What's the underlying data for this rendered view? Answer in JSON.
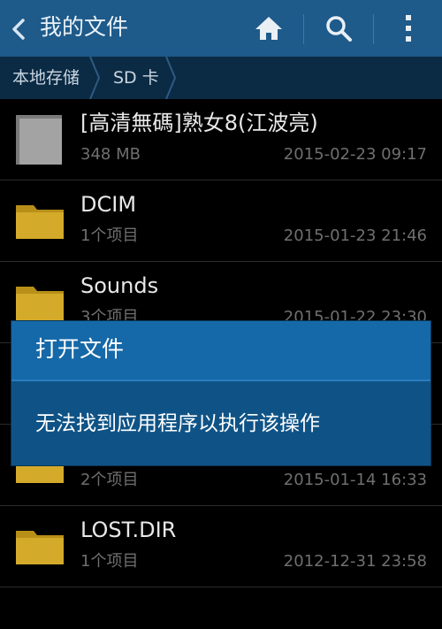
{
  "action_bar": {
    "title": "我的文件",
    "icons": [
      "back-icon",
      "home-icon",
      "search-icon",
      "more-icon"
    ],
    "color": "#1e5a8a"
  },
  "breadcrumb": {
    "items": [
      "本地存储",
      "SD 卡"
    ]
  },
  "files": [
    {
      "name": "[高清無碼]熟女8(江波亮)",
      "sub": "348 MB",
      "date": "2015-02-23 09:17",
      "icon": "file-icon"
    },
    {
      "name": "DCIM",
      "sub": "1个项目",
      "date": "2015-01-23 21:46",
      "icon": "folder-icon"
    },
    {
      "name": "Sounds",
      "sub": "3个项目",
      "date": "2015-01-22 23:30",
      "icon": "folder-icon"
    },
    {
      "name": "",
      "sub": "",
      "date": "",
      "icon": "folder-icon"
    },
    {
      "name": "",
      "sub": "2个项目",
      "date": "2015-01-14 16:33",
      "icon": "folder-icon"
    },
    {
      "name": "LOST.DIR",
      "sub": "1个项目",
      "date": "2012-12-31 23:58",
      "icon": "folder-icon"
    }
  ],
  "dialog": {
    "title": "打开文件",
    "message": "无法找到应用程序以执行该操作"
  },
  "colors": {
    "folder": "#d4aa2a",
    "dialog_bg": "#0f5386",
    "dialog_title_bg": "#1669a8"
  }
}
